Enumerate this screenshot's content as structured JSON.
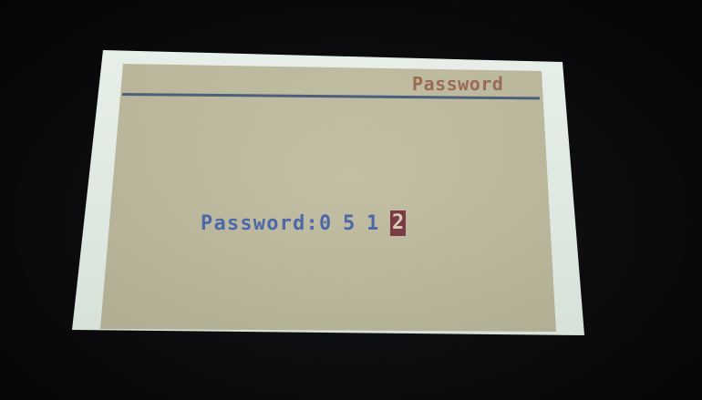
{
  "screen": {
    "title": "Password"
  },
  "password_entry": {
    "label": "Password:",
    "digits": [
      "0",
      "5",
      "1",
      "2"
    ],
    "cursor_index": 3
  },
  "colors": {
    "lcd_background": "#bdb99d",
    "title_text": "#9a6a55",
    "rule": "#4d5f7a",
    "field_text": "#4c68a8",
    "cursor_highlight": "#7a3b45"
  }
}
